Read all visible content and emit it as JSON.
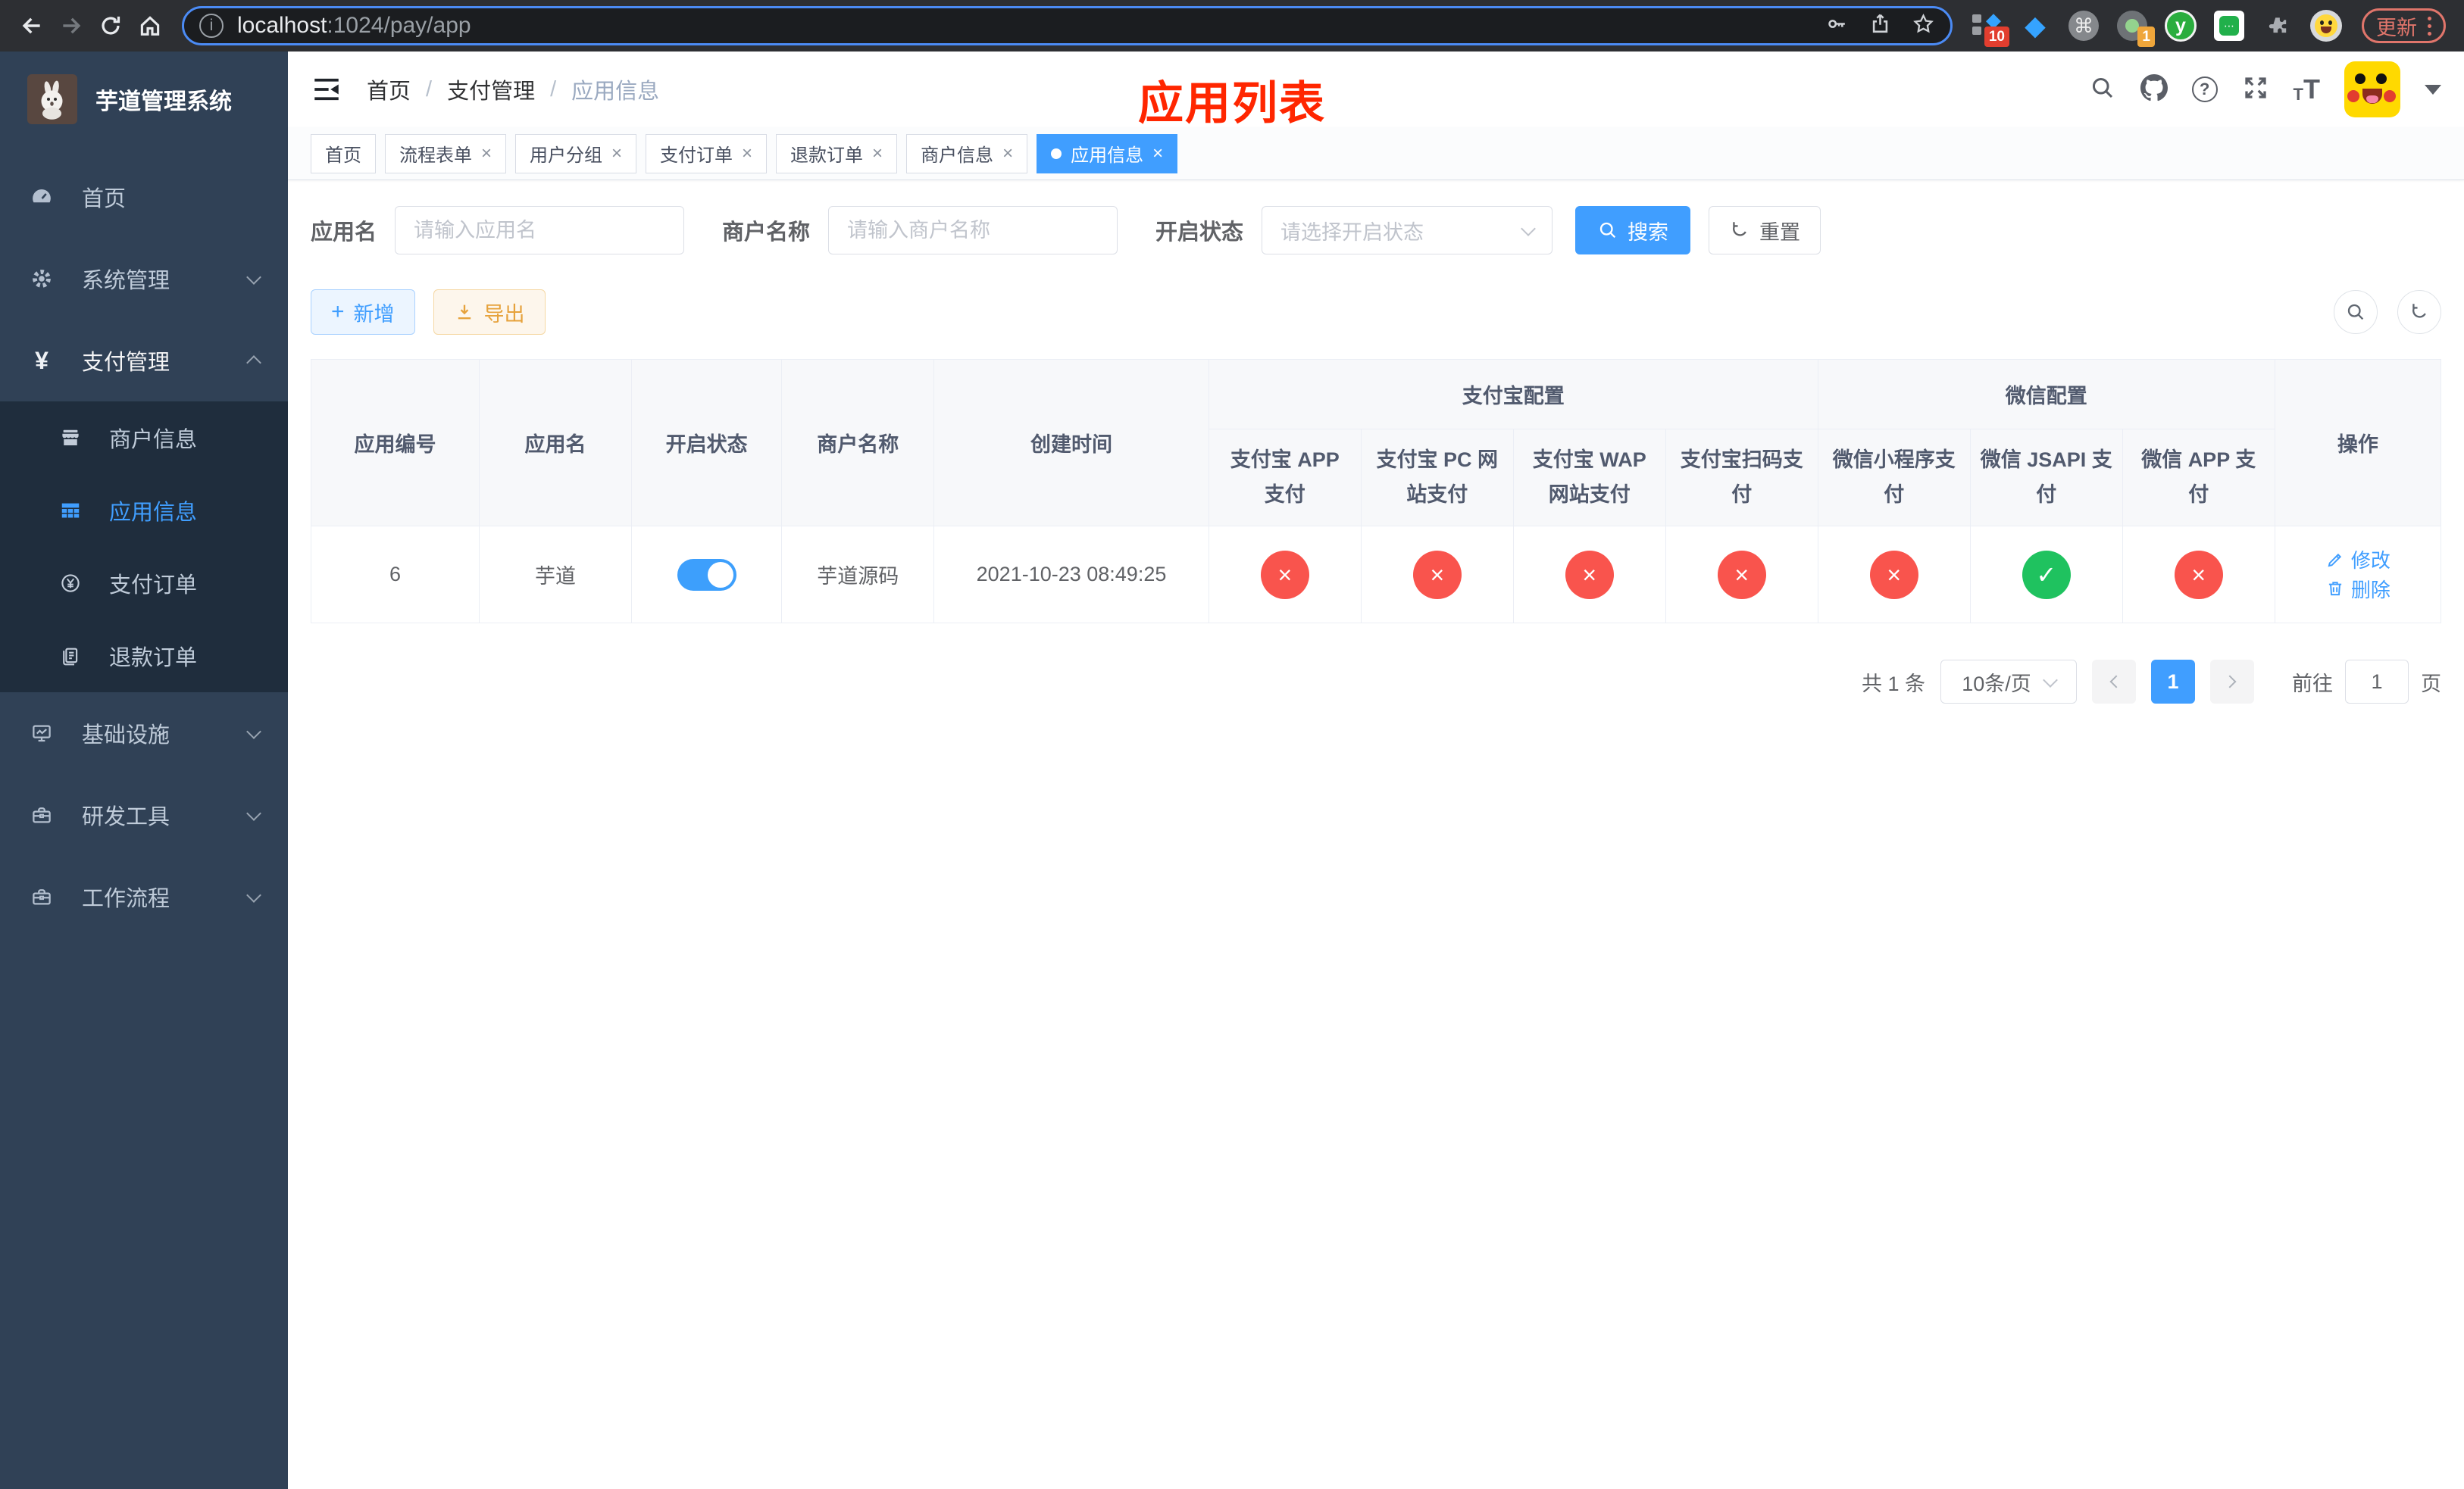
{
  "browser": {
    "url_host": "localhost",
    "url_path": ":1024/pay/app",
    "ext_badge_10": "10",
    "ext_badge_1": "1",
    "ext_y_label": "y",
    "update_label": "更新"
  },
  "sidebar": {
    "logo_title": "芋道管理系统",
    "items": [
      {
        "label": "首页"
      },
      {
        "label": "系统管理"
      },
      {
        "label": "支付管理"
      },
      {
        "label": "商户信息"
      },
      {
        "label": "应用信息"
      },
      {
        "label": "支付订单"
      },
      {
        "label": "退款订单"
      },
      {
        "label": "基础设施"
      },
      {
        "label": "研发工具"
      },
      {
        "label": "工作流程"
      }
    ]
  },
  "header": {
    "breadcrumb": [
      {
        "label": "首页"
      },
      {
        "label": "支付管理"
      },
      {
        "label": "应用信息"
      }
    ],
    "separator": "/",
    "annotation": "应用列表"
  },
  "tabs": [
    {
      "label": "首页"
    },
    {
      "label": "流程表单"
    },
    {
      "label": "用户分组"
    },
    {
      "label": "支付订单"
    },
    {
      "label": "退款订单"
    },
    {
      "label": "商户信息"
    },
    {
      "label": "应用信息"
    }
  ],
  "filters": {
    "app_name_label": "应用名",
    "app_name_placeholder": "请输入应用名",
    "merchant_label": "商户名称",
    "merchant_placeholder": "请输入商户名称",
    "status_label": "开启状态",
    "status_placeholder": "请选择开启状态",
    "search_label": "搜索",
    "reset_label": "重置"
  },
  "toolbar": {
    "add_label": "新增",
    "export_label": "导出"
  },
  "table": {
    "columns": {
      "app_id": "应用编号",
      "app_name": "应用名",
      "status": "开启状态",
      "merchant": "商户名称",
      "created": "创建时间",
      "op": "操作"
    },
    "groups": {
      "alipay": "支付宝配置",
      "wechat": "微信配置"
    },
    "sub_columns": [
      {
        "label": "支付宝 APP 支付"
      },
      {
        "label": "支付宝 PC 网站支付"
      },
      {
        "label": "支付宝 WAP 网站支付"
      },
      {
        "label": "支付宝扫码支付"
      },
      {
        "label": "微信小程序支付"
      },
      {
        "label": "微信 JSAPI 支付"
      },
      {
        "label": "微信 APP 支付"
      }
    ],
    "rows": [
      {
        "app_id": "6",
        "app_name": "芋道",
        "merchant": "芋道源码",
        "created": "2021-10-23 08:49:25",
        "statuses": [
          {
            "cls": "st off",
            "glyph": "×"
          },
          {
            "cls": "st off",
            "glyph": "×"
          },
          {
            "cls": "st off",
            "glyph": "×"
          },
          {
            "cls": "st off",
            "glyph": "×"
          },
          {
            "cls": "st off",
            "glyph": "×"
          },
          {
            "cls": "st on",
            "glyph": "✓"
          },
          {
            "cls": "st off",
            "glyph": "×"
          }
        ],
        "edit_label": "修改",
        "delete_label": "删除"
      }
    ]
  },
  "pagination": {
    "total_label": "共 1 条",
    "page_size_label": "10条/页",
    "current_page": "1",
    "goto_label": "前往",
    "goto_value": "1",
    "page_unit": "页"
  },
  "colors": {
    "primary": "#409eff",
    "success": "#1fc25f",
    "danger": "#f9544d",
    "warning": "#e6a23c",
    "annotation_red": "#ff2600",
    "sidebar_bg": "#304156",
    "submenu_bg": "#1f2d3d"
  }
}
